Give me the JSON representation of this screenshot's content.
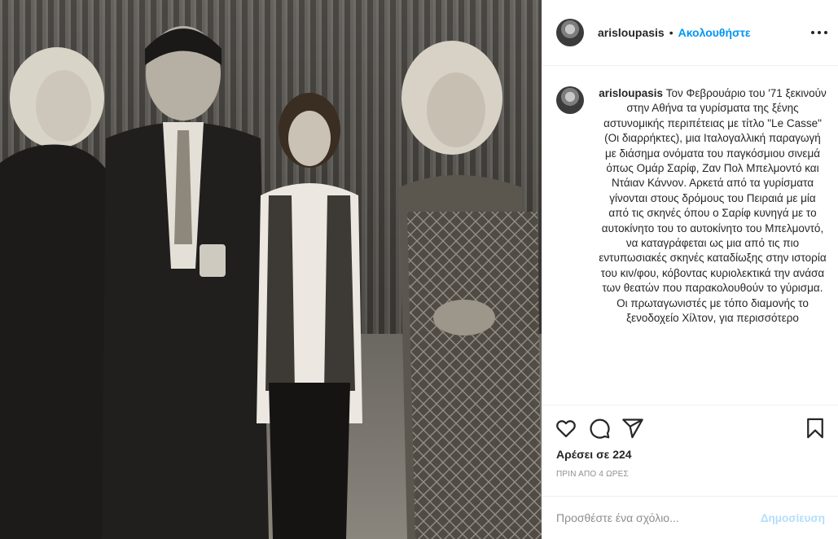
{
  "post": {
    "photo_alt": "black and white photo",
    "header": {
      "username": "arisloupasis",
      "separator": "•",
      "follow_label": "Ακολουθήστε",
      "more_icon": "more-horizontal-icon"
    },
    "caption": {
      "username": "arisloupasis",
      "text": "Τον Φεβρουάριο του '71 ξεκινούν στην Αθήνα τα γυρίσματα της ξένης αστυνομικής περιπέτειας με τίτλο \"Le Casse\" (Οι διαρρήκτες), μια Ιταλογαλλική παραγωγή με διάσημα ονόματα του παγκόσμιου σινεμά όπως Ομάρ Σαρίφ, Ζαν Πολ Μπελμοντό και Ντάιαν Κάννον. Αρκετά από τα γυρίσματα γίνονται στους δρόμους του Πειραιά με μία από τις σκηνές όπου ο Σαρίφ κυνηγά με το αυτοκίνητο του το αυτοκίνητο του Μπελμοντό, να καταγράφεται ως μια από τις πιο εντυπωσιακές σκηνές καταδίωξης στην ιστορία του κιν/φου, κόβοντας κυριολεκτικά την ανάσα των θεατών που παρακολουθούν το γύρισμα. Οι πρωταγωνιστές με τόπο διαμονής το ξενοδοχείο Χίλτον, για περισσότερο"
    },
    "actions": {
      "icons": [
        "heart-icon",
        "comment-icon",
        "share-icon",
        "bookmark-icon"
      ]
    },
    "likes_label": "Αρέσει σε 224",
    "timestamp": "ΠΡΙΝ ΑΠΟ 4 ΩΡΕΣ",
    "comment": {
      "placeholder": "Προσθέστε ένα σχόλιο...",
      "value": "",
      "submit_label": "Δημοσίευση"
    }
  },
  "colors": {
    "link_blue": "#0095f6",
    "disabled_blue": "#b2dffc",
    "text": "#262626",
    "muted": "#8e8e8e",
    "border": "#efefef"
  }
}
